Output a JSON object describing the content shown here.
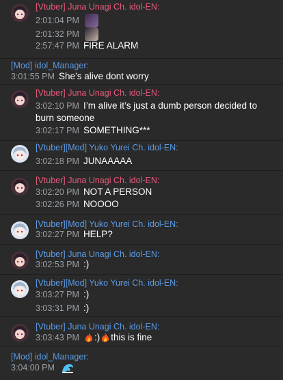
{
  "groups": [
    {
      "author": "[Vtuber] Juna Unagi Ch. idol-EN:",
      "avatar": "juna-avatar",
      "color": "#e8587a",
      "lines": [
        {
          "time": "2:01:04 PM",
          "text": ""
        },
        {
          "time": "2:01:32 PM",
          "text": ""
        },
        {
          "time": "2:57:47 PM",
          "text": "FIRE ALARM"
        }
      ]
    },
    {
      "author": "[Mod] idol_Manager:",
      "color": "#5b9be6",
      "lines": [
        {
          "time": "3:01:55 PM",
          "text": "She’s alive dont worry"
        }
      ]
    },
    {
      "author": "[Vtuber] Juna Unagi Ch. idol-EN:",
      "avatar": "juna-avatar",
      "color": "#e8587a",
      "lines": [
        {
          "time": "3:02:10 PM",
          "text": "I’m alive it’s just a dumb person decided to burn someone"
        },
        {
          "time": "3:02:17 PM",
          "text": "SOMETHING***"
        }
      ]
    },
    {
      "author": "[Vtuber][Mod] Yuko Yurei Ch. idol-EN:",
      "avatar": "yuko-avatar",
      "color": "#5b9be6",
      "lines": [
        {
          "time": "3:02:18 PM",
          "text": "JUNAAAAA"
        }
      ]
    },
    {
      "author": "[Vtuber] Juna Unagi Ch. idol-EN:",
      "avatar": "juna-avatar",
      "color": "#e8587a",
      "lines": [
        {
          "time": "3:02:20 PM",
          "text": "NOT A PERSON"
        },
        {
          "time": "3:02:26 PM",
          "text": "NOOOO"
        }
      ]
    },
    {
      "author": "[Vtuber][Mod] Yuko Yurei Ch. idol-EN:",
      "avatar": "yuko-avatar",
      "color": "#5b9be6",
      "lines": [
        {
          "time": "3:02:27 PM",
          "text": "HELP?"
        }
      ]
    },
    {
      "author": "[Vtuber] Juna Unagi Ch. idol-EN:",
      "avatar": "juna-avatar",
      "color": "#5b9be6",
      "lines": [
        {
          "time": "3:02:53 PM",
          "text": ":)"
        }
      ]
    },
    {
      "author": "[Vtuber][Mod] Yuko Yurei Ch. idol-EN:",
      "avatar": "yuko-avatar",
      "color": "#5b9be6",
      "lines": [
        {
          "time": "3:03:27 PM",
          "text": ":)"
        },
        {
          "time": "3:03:31 PM",
          "text": ":)"
        }
      ]
    },
    {
      "author": "[Vtuber] Juna Unagi Ch. idol-EN:",
      "avatar": "juna-avatar",
      "color": "#5b9be6",
      "lines": [
        {
          "time": "3:03:43 PM",
          "text_a": ":)",
          "text_b": "this is fine"
        }
      ]
    },
    {
      "author": "[Mod] idol_Manager:",
      "color": "#5b9be6",
      "lines": [
        {
          "time": "3:04:00 PM",
          "text": ""
        }
      ]
    }
  ],
  "colors": {
    "background": "#2a2a2a",
    "pink": "#e8587a",
    "blue": "#5b9be6",
    "timestamp": "#9aa0a6"
  },
  "icons": {
    "fire": "fire-emoji",
    "wave": "wave-emoji"
  }
}
